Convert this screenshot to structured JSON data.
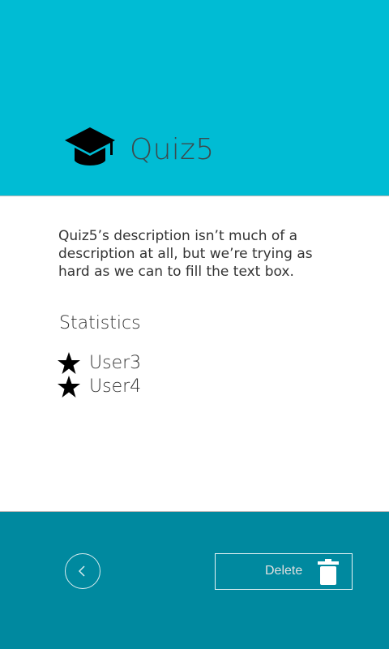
{
  "header": {
    "title": "Quiz5",
    "icon": "graduation-cap-icon",
    "background_color": "#00bcd4"
  },
  "main": {
    "description": "Quiz5’s description isn’t much of a description at all, but we’re trying as hard as we can to fill the text box.",
    "statistics_heading": "Statistics",
    "users": [
      {
        "name": "User3",
        "icon": "star-icon"
      },
      {
        "name": "User4",
        "icon": "star-icon"
      }
    ]
  },
  "footer": {
    "background_color": "#00899f",
    "back_icon": "chevron-left-icon",
    "delete_label": "Delete",
    "delete_icon": "trash-icon"
  }
}
